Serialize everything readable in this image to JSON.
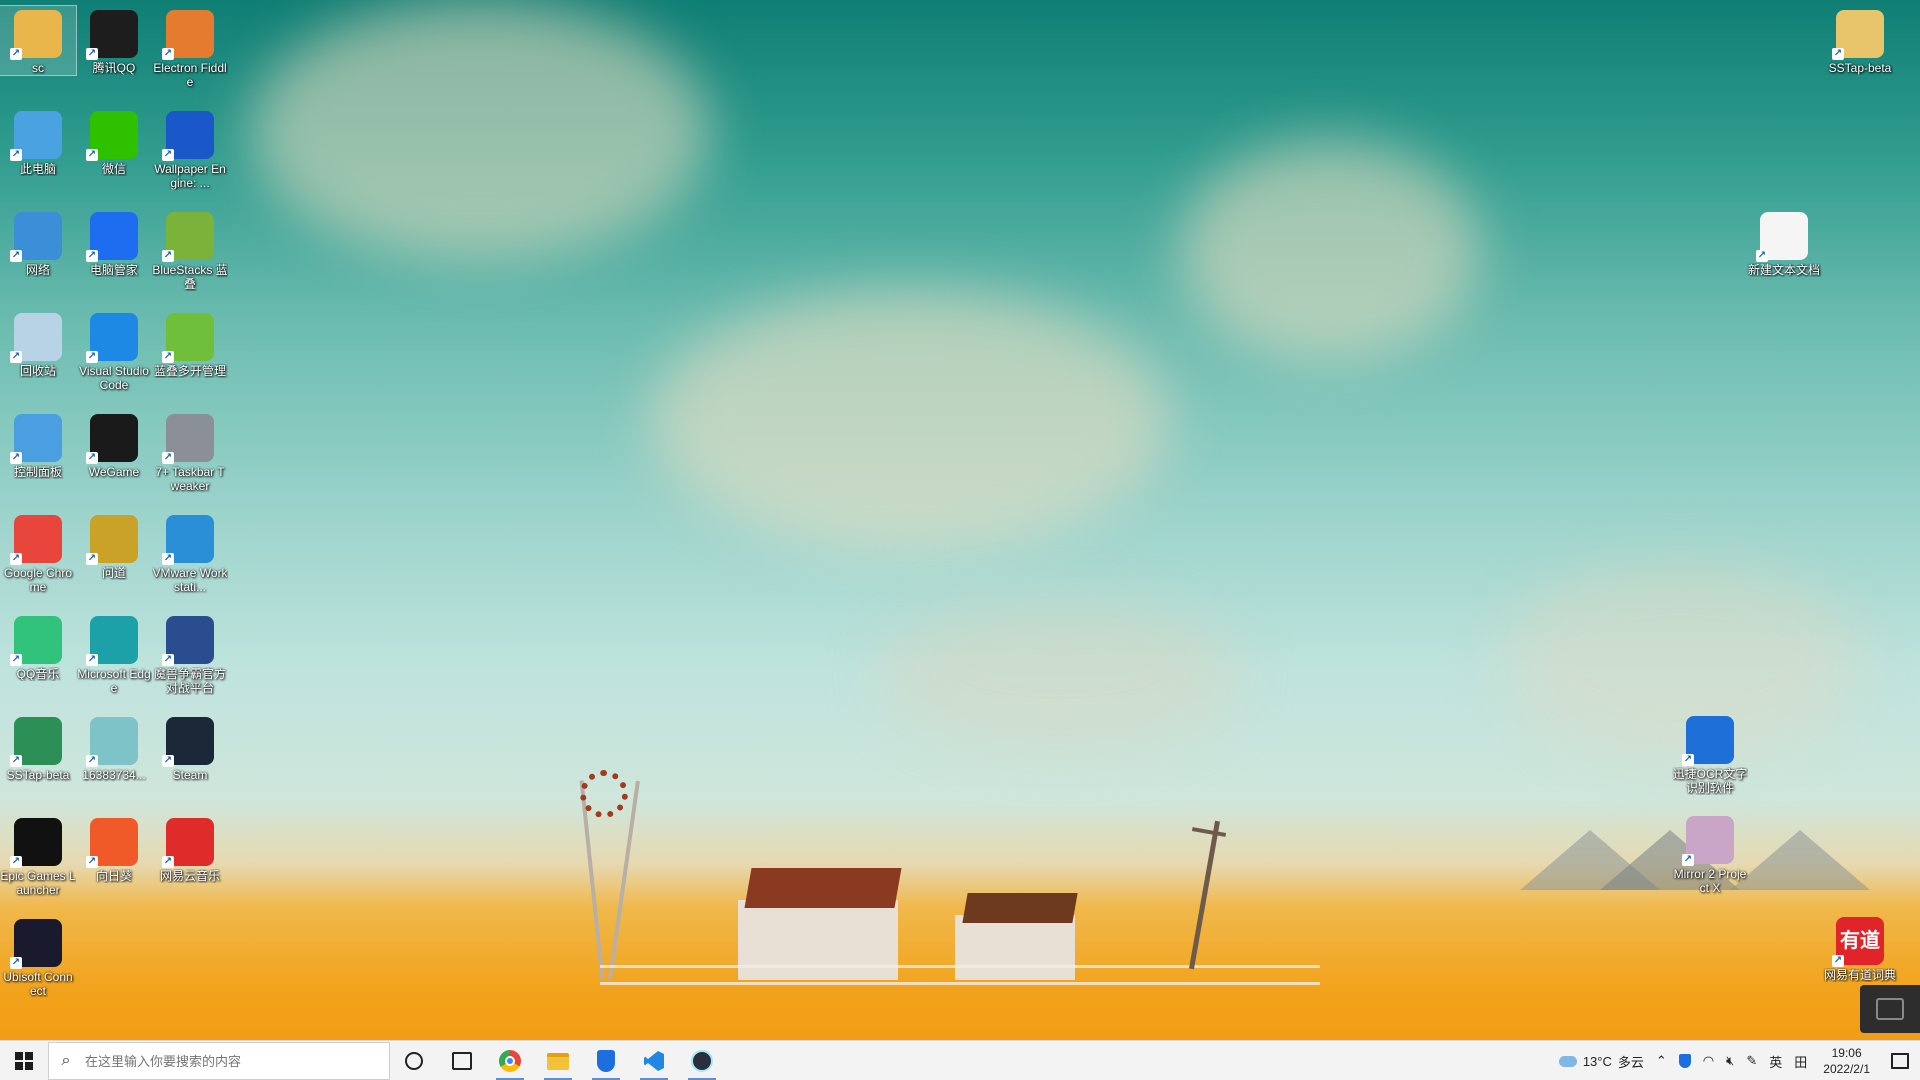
{
  "desktop": {
    "left_icons": [
      {
        "name": "sc",
        "icon": "folder-user-icon",
        "color": "#e8b64a",
        "selected": true
      },
      {
        "name": "腾讯QQ",
        "icon": "qq-penguin-icon",
        "color": "#1d1d1d"
      },
      {
        "name": "Electron Fiddle",
        "icon": "electron-fiddle-icon",
        "color": "#e57b2e"
      },
      {
        "name": "此电脑",
        "icon": "computer-icon",
        "color": "#4aa3e0"
      },
      {
        "name": "微信",
        "icon": "wechat-icon",
        "color": "#2dc100"
      },
      {
        "name": "Wallpaper Engine: ...",
        "icon": "wallpaper-engine-icon",
        "color": "#1a57c8"
      },
      {
        "name": "网络",
        "icon": "network-icon",
        "color": "#3a8fd8"
      },
      {
        "name": "电脑管家",
        "icon": "pc-manager-icon",
        "color": "#1e6cf0"
      },
      {
        "name": "BlueStacks 蓝叠",
        "icon": "bluestacks-icon",
        "color": "#7ab23a"
      },
      {
        "name": "回收站",
        "icon": "recycle-bin-icon",
        "color": "#b9d3e6"
      },
      {
        "name": "Visual Studio Code",
        "icon": "vscode-icon",
        "color": "#1e88e5"
      },
      {
        "name": "蓝叠多开管理",
        "icon": "bluestacks-multi-icon",
        "color": "#6fbf3a"
      },
      {
        "name": "控制面板",
        "icon": "control-panel-icon",
        "color": "#4a9fe0"
      },
      {
        "name": "WeGame",
        "icon": "wegame-icon",
        "color": "#1a1a1a"
      },
      {
        "name": "7+ Taskbar Tweaker",
        "icon": "taskbar-tweaker-icon",
        "color": "#8a8f98"
      },
      {
        "name": "Google Chrome",
        "icon": "chrome-icon",
        "color": "#e8453c"
      },
      {
        "name": "问道",
        "icon": "wendao-icon",
        "color": "#c9a227"
      },
      {
        "name": "VMware Workstati...",
        "icon": "vmware-icon",
        "color": "#2a8fd6"
      },
      {
        "name": "QQ音乐",
        "icon": "qq-music-icon",
        "color": "#31c27c"
      },
      {
        "name": "Microsoft Edge",
        "icon": "edge-icon",
        "color": "#1da1a8"
      },
      {
        "name": "魔兽争霸官方对战平台",
        "icon": "warcraft-platform-icon",
        "color": "#2a4d8f"
      },
      {
        "name": "SSTap-beta",
        "icon": "sstap-icon",
        "color": "#2b8f56"
      },
      {
        "name": "16383734...",
        "icon": "image-file-icon",
        "color": "#7ec3c8"
      },
      {
        "name": "Steam",
        "icon": "steam-icon",
        "color": "#1b2838"
      },
      {
        "name": "Epic Games Launcher",
        "icon": "epic-games-icon",
        "color": "#111111"
      },
      {
        "name": "向日葵",
        "icon": "sunlogin-icon",
        "color": "#f05a28"
      },
      {
        "name": "网易云音乐",
        "icon": "netease-music-icon",
        "color": "#e02b2b"
      },
      {
        "name": "Ubisoft Connect",
        "icon": "ubisoft-icon",
        "color": "#1a1a2e"
      }
    ],
    "right_icons": [
      {
        "name": "SSTap-beta",
        "icon": "folder-icon",
        "color": "#e8c46a"
      },
      {
        "name": "新建文本文档",
        "icon": "text-document-icon",
        "color": "#f5f5f5"
      },
      {
        "name": "迅捷OCR文字识别软件",
        "icon": "ocr-icon",
        "color": "#1e6fd8"
      },
      {
        "name": "Mirror 2 Project X",
        "icon": "mirror2-icon",
        "color": "#c9a6c8"
      },
      {
        "name": "网易有道词典",
        "icon": "youdao-icon",
        "color": "#e0242a"
      }
    ],
    "youdao_badge_text": "有道"
  },
  "taskbar": {
    "search_placeholder": "在这里输入你要搜索的内容",
    "pinned": [
      {
        "name": "cortana-icon"
      },
      {
        "name": "task-view-icon"
      },
      {
        "name": "chrome-icon",
        "running": true
      },
      {
        "name": "file-explorer-icon",
        "running": true
      },
      {
        "name": "security-shield-icon",
        "running": true
      },
      {
        "name": "vscode-icon",
        "running": true
      },
      {
        "name": "electron-icon",
        "running": true
      }
    ],
    "weather": {
      "temp": "13°C",
      "condition": "多云"
    },
    "ime": "英",
    "clock": {
      "time": "19:06",
      "date": "2022/2/1"
    }
  }
}
